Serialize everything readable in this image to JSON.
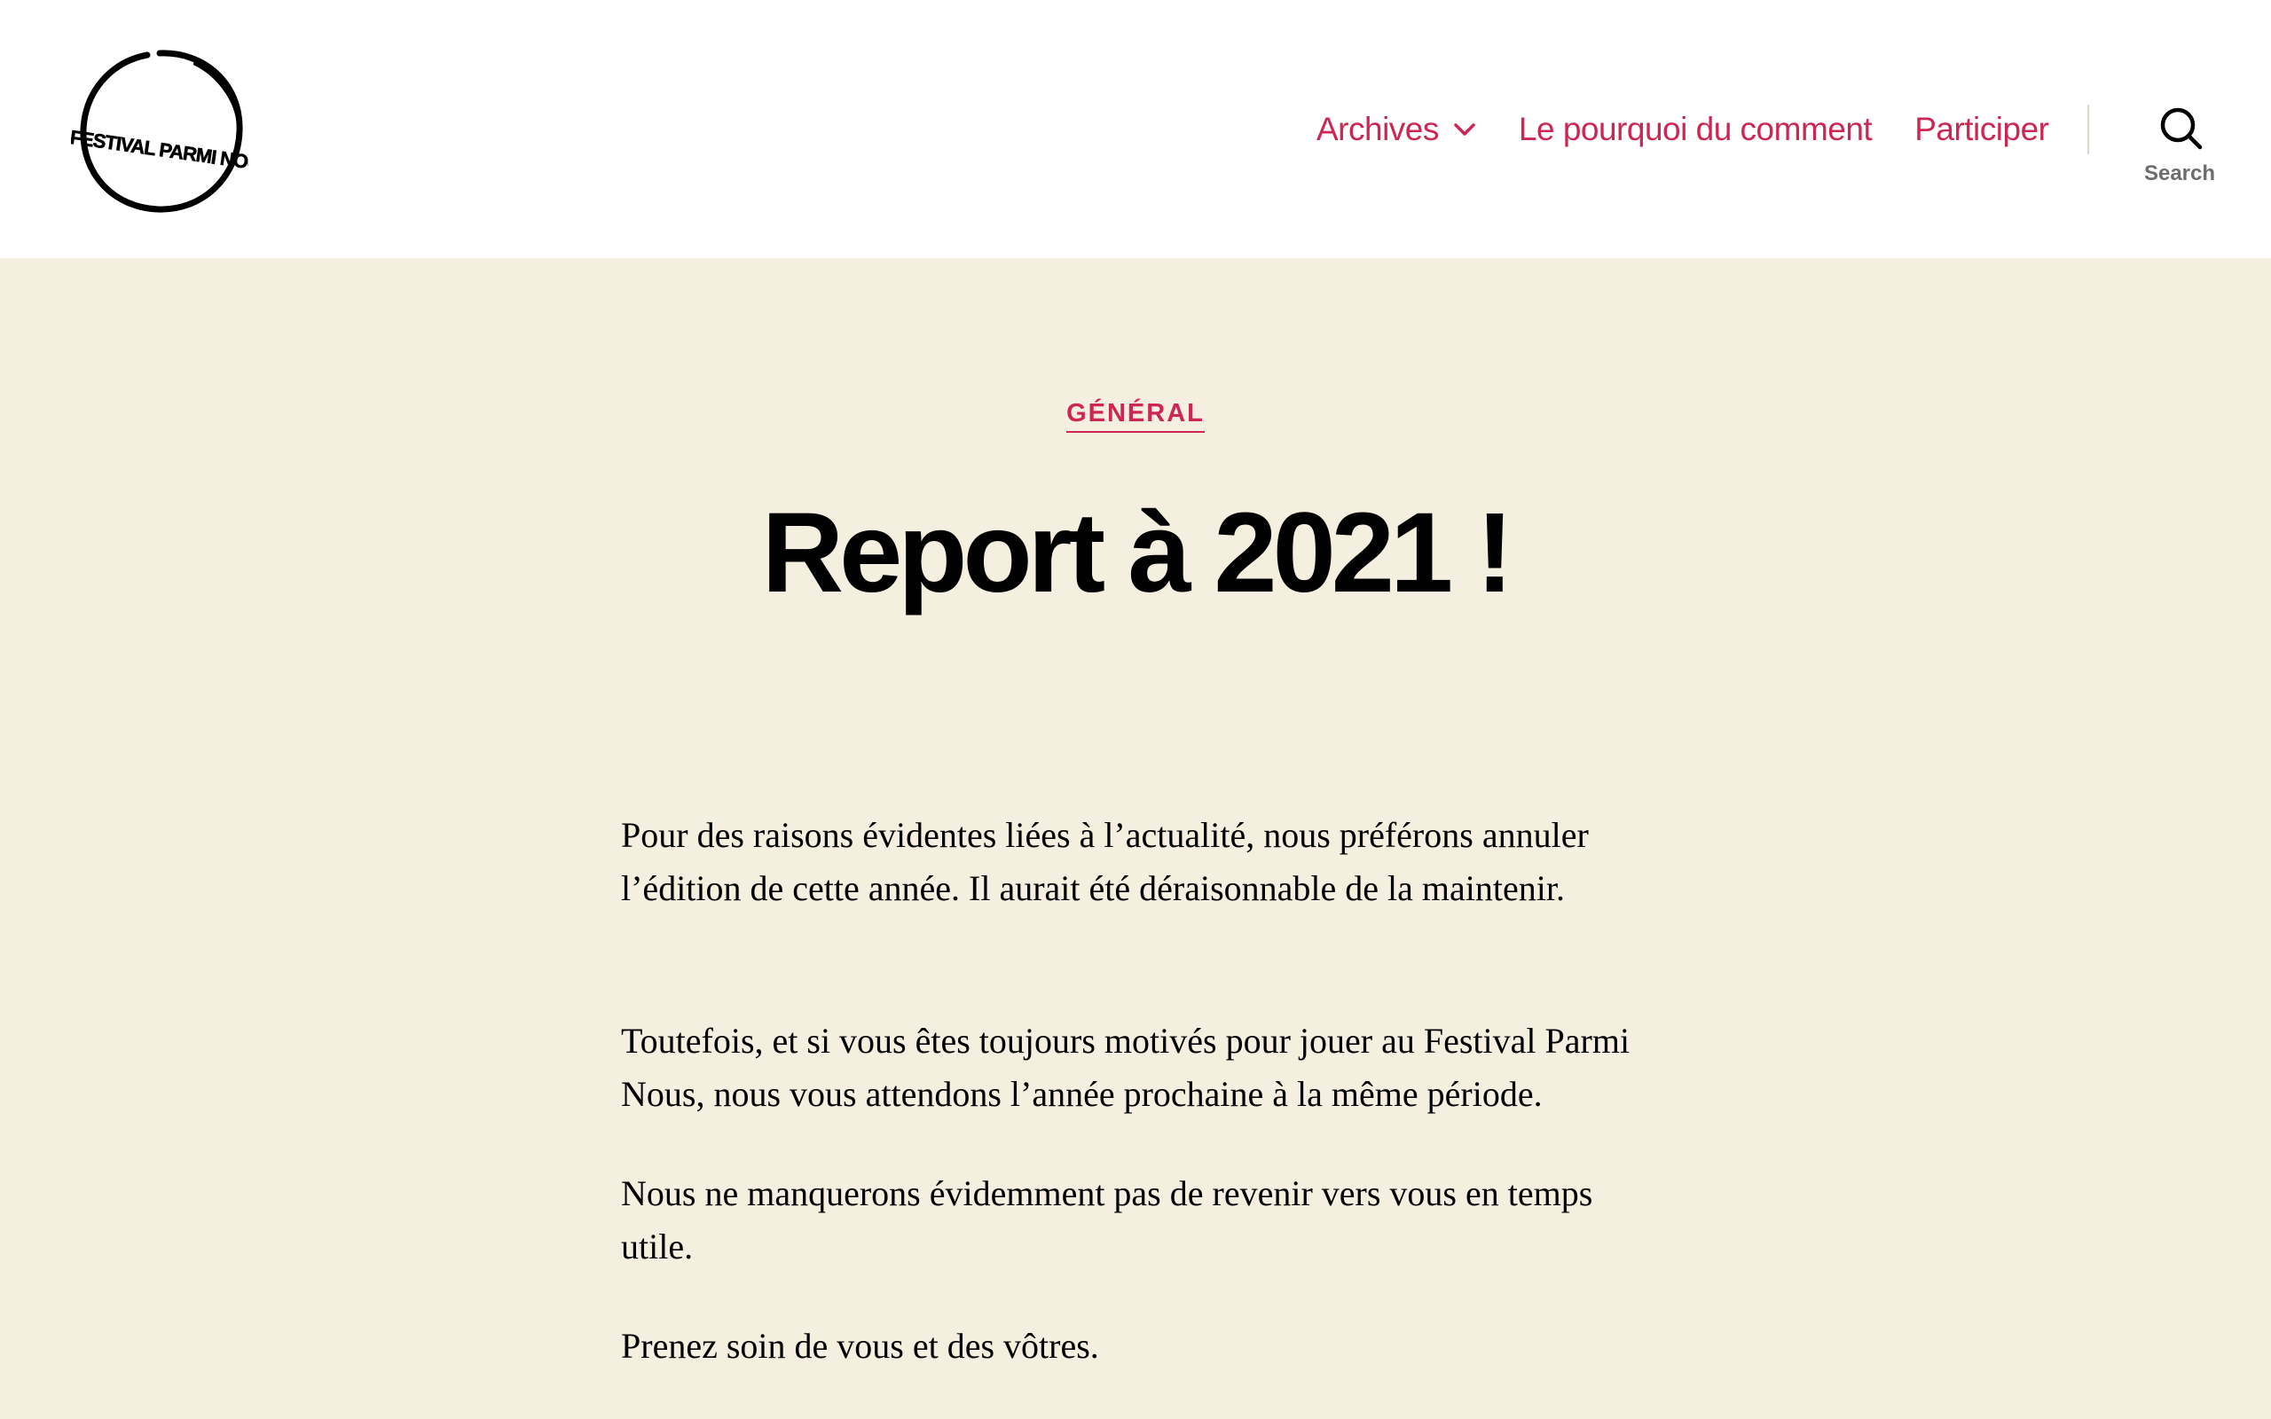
{
  "site": {
    "logo_text": "Festival Parmi Nous"
  },
  "nav": {
    "items": [
      {
        "label": "Archives",
        "has_submenu": true
      },
      {
        "label": "Le pourquoi du comment"
      },
      {
        "label": "Participer"
      }
    ],
    "search_label": "Search"
  },
  "post": {
    "category": "GÉNÉRAL",
    "title": "Report à 2021 !",
    "paragraphs": [
      "Pour des raisons évidentes liées à l’actualité, nous préférons annuler l’édition de cette année. Il aurait été déraisonnable de la maintenir.",
      "Toutefois, et si vous êtes toujours motivés pour jouer au Festival Parmi Nous, nous vous attendons l’année prochaine à la même période.",
      "Nous ne manquerons évidemment pas de revenir vers vous en temps utile.",
      "Prenez soin de vous et des vôtres."
    ]
  },
  "colors": {
    "accent": "#cd2653",
    "background": "#f5efe0",
    "header_background": "#ffffff",
    "text": "#000000",
    "muted": "#6d6d6d"
  },
  "icons": {
    "logo": "festival-parmi-nous-logo",
    "submenu": "chevron-down-icon",
    "search": "search-icon"
  }
}
